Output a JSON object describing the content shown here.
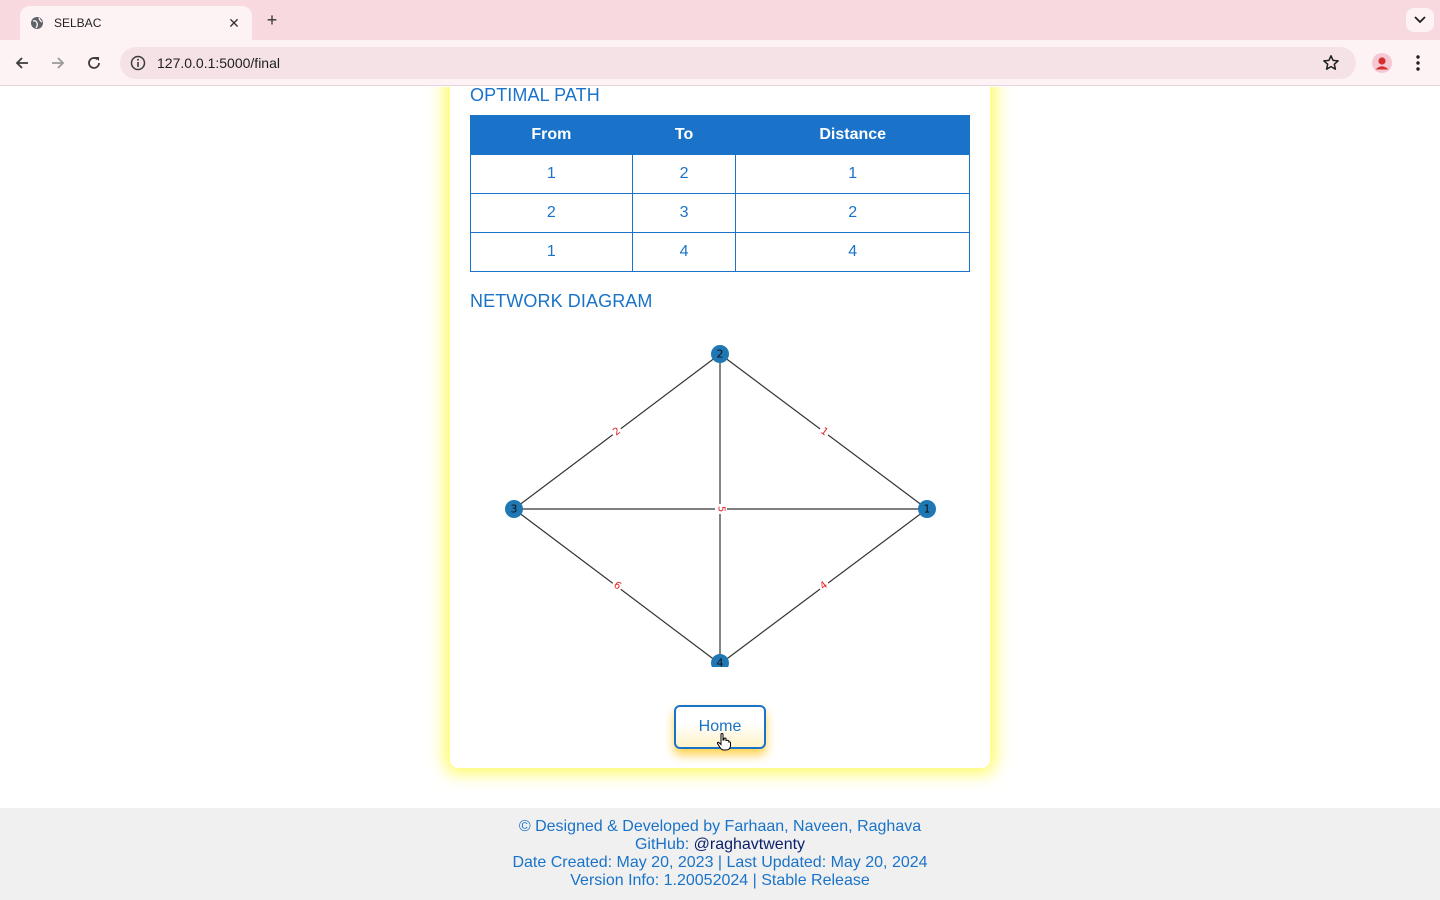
{
  "browser": {
    "tab_title": "SELBAC",
    "url": "127.0.0.1:5000/final"
  },
  "page": {
    "optimal_path_title": "OPTIMAL PATH",
    "network_diagram_title": "NETWORK DIAGRAM",
    "table": {
      "headers": [
        "From",
        "To",
        "Distance"
      ],
      "rows": [
        [
          "1",
          "2",
          "1"
        ],
        [
          "2",
          "3",
          "2"
        ],
        [
          "1",
          "4",
          "4"
        ]
      ]
    },
    "graph": {
      "nodes": [
        "1",
        "2",
        "3",
        "4"
      ],
      "edges": [
        {
          "from": "2",
          "to": "1",
          "weight": "1"
        },
        {
          "from": "2",
          "to": "3",
          "weight": "2"
        },
        {
          "from": "3",
          "to": "1",
          "weight": "5"
        },
        {
          "from": "2",
          "to": "4",
          "weight": "5"
        },
        {
          "from": "3",
          "to": "4",
          "weight": "6"
        },
        {
          "from": "4",
          "to": "1",
          "weight": "4"
        }
      ]
    },
    "home_button": "Home"
  },
  "footer": {
    "line1": "© Designed & Developed by Farhaan, Naveen, Raghava",
    "github_label": "GitHub: ",
    "github_handle": "@raghavtwenty",
    "dates": "Date Created: May 20, 2023 | Last Updated: May 20, 2024",
    "version": "Version Info: 1.20052024 | Stable Release"
  },
  "colors": {
    "accent": "#1a73c8",
    "node": "#1f77b4",
    "edge_label": "#e02020",
    "glow": "#fffa50"
  }
}
